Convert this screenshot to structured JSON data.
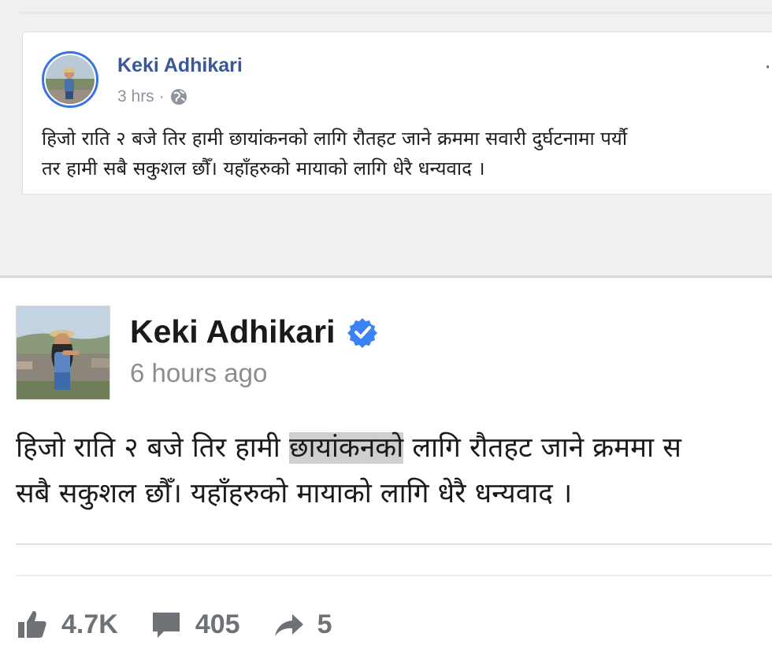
{
  "desktop_post": {
    "author": "Keki Adhikari",
    "time": "3 hrs",
    "separator": "·",
    "text_line1": "हिजो राति २ बजे तिर हामी छायांकनको लागि रौतहट जाने क्रममा सवारी दुर्घटनामा पर्यौ",
    "text_line2": "तर हामी सबै सकुशल छौँ। यहाँहरुको मायाको लागि धेरै धन्यवाद ।",
    "menu_glyph": "··"
  },
  "mobile_post": {
    "author": "Keki Adhikari",
    "time": "6 hours ago",
    "text_line1_before": "हिजो राति २ बजे तिर हामी ",
    "text_line1_highlight": "छायांकनको",
    "text_line1_after": " लागि रौतहट जाने क्रममा स",
    "text_line2": "सबै सकुशल छौँ। यहाँहरुको मायाको लागि धेरै धन्यवाद ।",
    "actions": {
      "likes": "4.7K",
      "comments": "405",
      "shares": "5"
    }
  },
  "icons": {
    "globe": "globe-icon",
    "verified": "verified-badge-icon",
    "like": "thumbs-up-icon",
    "comment": "comment-bubble-icon",
    "share": "share-arrow-icon"
  },
  "colors": {
    "fb_link": "#385898",
    "verified": "#3b82f6",
    "highlight": "#cfcfcf",
    "action_gray": "#6e7175"
  }
}
